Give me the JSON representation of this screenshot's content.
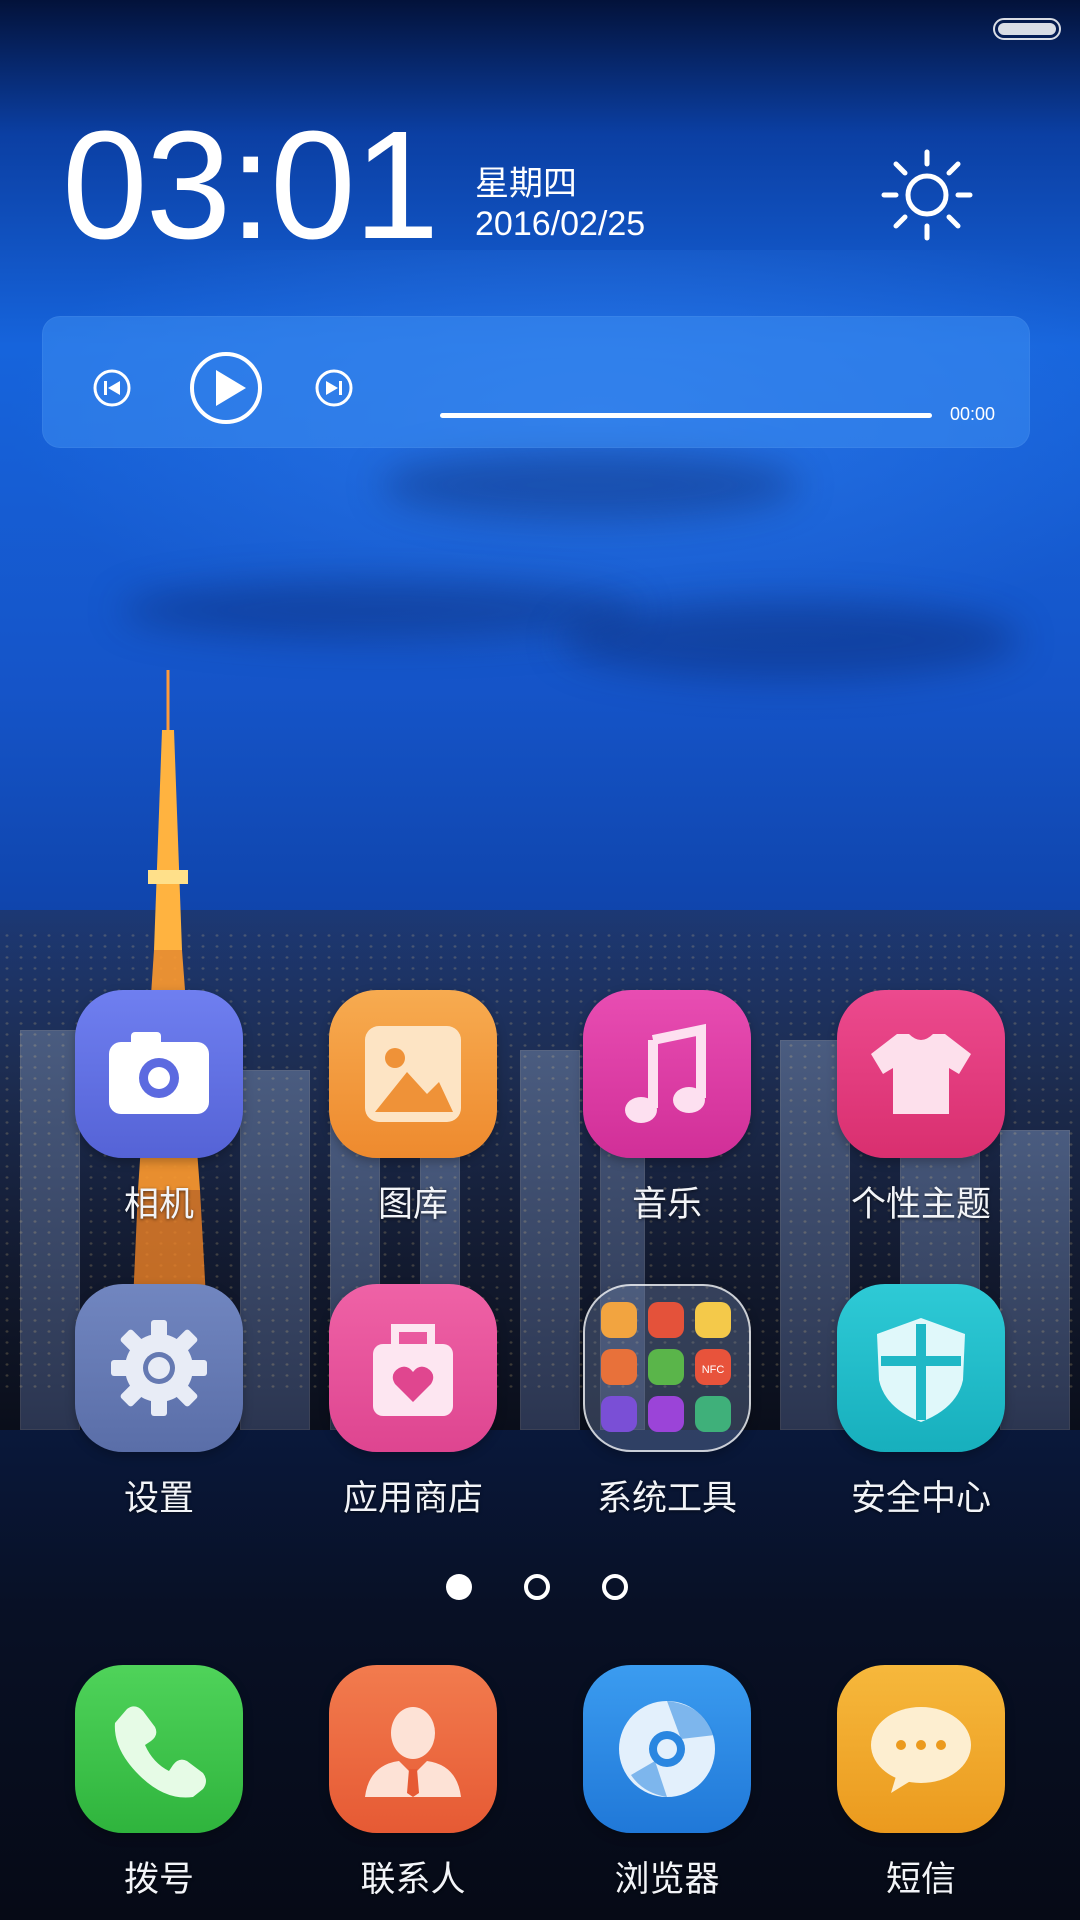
{
  "clock": {
    "time": "03:01",
    "weekday": "星期四",
    "date": "2016/02/25",
    "weather_icon": "sun-icon"
  },
  "player": {
    "time": "00:00",
    "progress": 0,
    "prev_icon": "previous-track-icon",
    "play_icon": "play-icon",
    "next_icon": "next-track-icon"
  },
  "apps_row1": [
    {
      "label": "相机",
      "icon": "camera-icon",
      "color": "#6272e0"
    },
    {
      "label": "图库",
      "icon": "gallery-icon",
      "color": "#f19a3e"
    },
    {
      "label": "音乐",
      "icon": "music-note-icon",
      "color": "#de3ea5"
    },
    {
      "label": "个性主题",
      "icon": "tshirt-icon",
      "color": "#e4387f"
    }
  ],
  "apps_row2": [
    {
      "label": "设置",
      "icon": "gear-icon",
      "color": "#6a7fb5"
    },
    {
      "label": "应用商店",
      "icon": "shopping-bag-icon",
      "color": "#e8539c"
    },
    {
      "label": "系统工具",
      "icon": "folder-icon",
      "color": "#4a5a80"
    },
    {
      "label": "安全中心",
      "icon": "shield-icon",
      "color": "#22c0cc"
    }
  ],
  "folder_mini": [
    "#f2a440",
    "#e4523a",
    "#f4c94a",
    "#e8713a",
    "#5ab54a",
    "#e8533b",
    "#7a4fd6",
    "#9b44d8",
    "#3fb07a"
  ],
  "folder_mini_text": {
    "nfc": "NFC"
  },
  "page_indicator": {
    "count": 3,
    "active": 0
  },
  "dock": [
    {
      "label": "拨号",
      "icon": "phone-icon",
      "color": "#3cbf48"
    },
    {
      "label": "联系人",
      "icon": "contact-icon",
      "color": "#ec6a40"
    },
    {
      "label": "浏览器",
      "icon": "browser-icon",
      "color": "#2f8fe6"
    },
    {
      "label": "短信",
      "icon": "message-icon",
      "color": "#f0a62a"
    }
  ]
}
